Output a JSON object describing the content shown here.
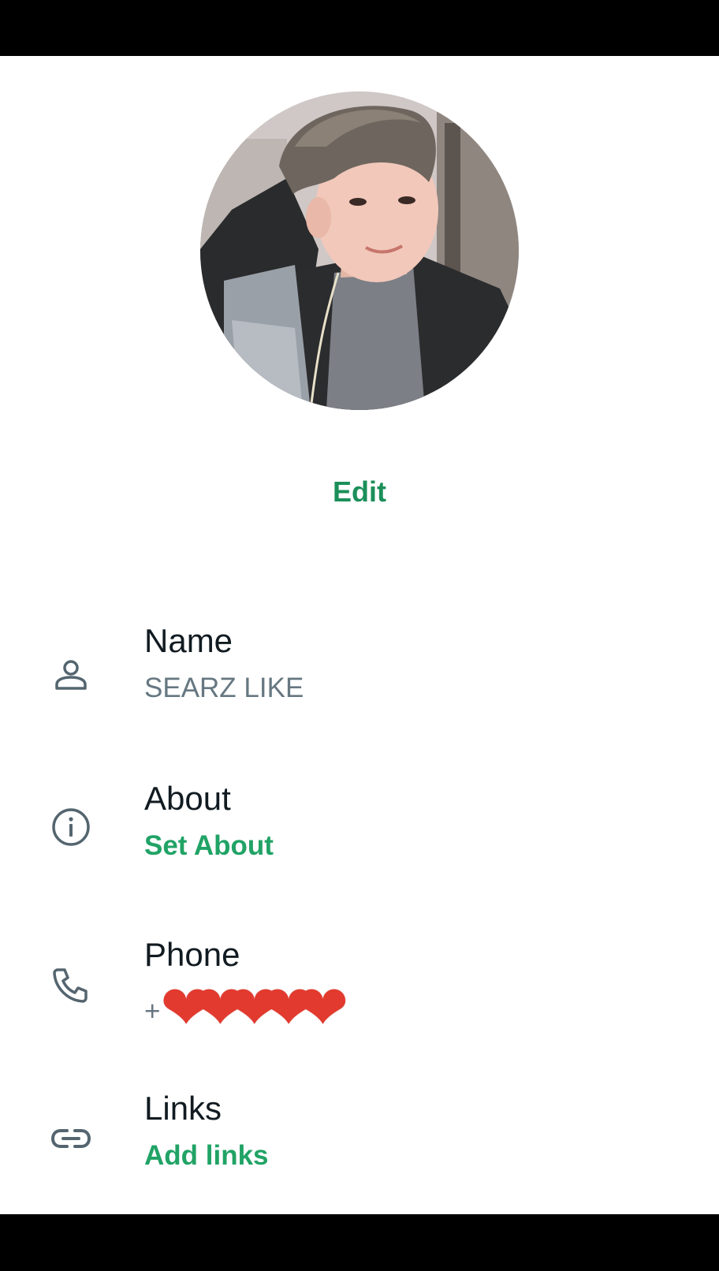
{
  "profile": {
    "edit_label": "Edit"
  },
  "rows": [
    {
      "label": "Name",
      "value": "SEARZ LIKE",
      "icon": "person-icon"
    },
    {
      "label": "About",
      "value": "Set About",
      "icon": "info-icon"
    },
    {
      "label": "Phone",
      "value_prefix": "+",
      "value_emoji": "❤❤❤❤❤",
      "icon": "phone-icon"
    },
    {
      "label": "Links",
      "value": "Add links",
      "icon": "link-icon"
    }
  ],
  "colors": {
    "accent": "#21a366",
    "accent_dark": "#1b8f5a",
    "text_primary": "#111b21",
    "text_secondary": "#667781",
    "icon": "#54656f"
  }
}
